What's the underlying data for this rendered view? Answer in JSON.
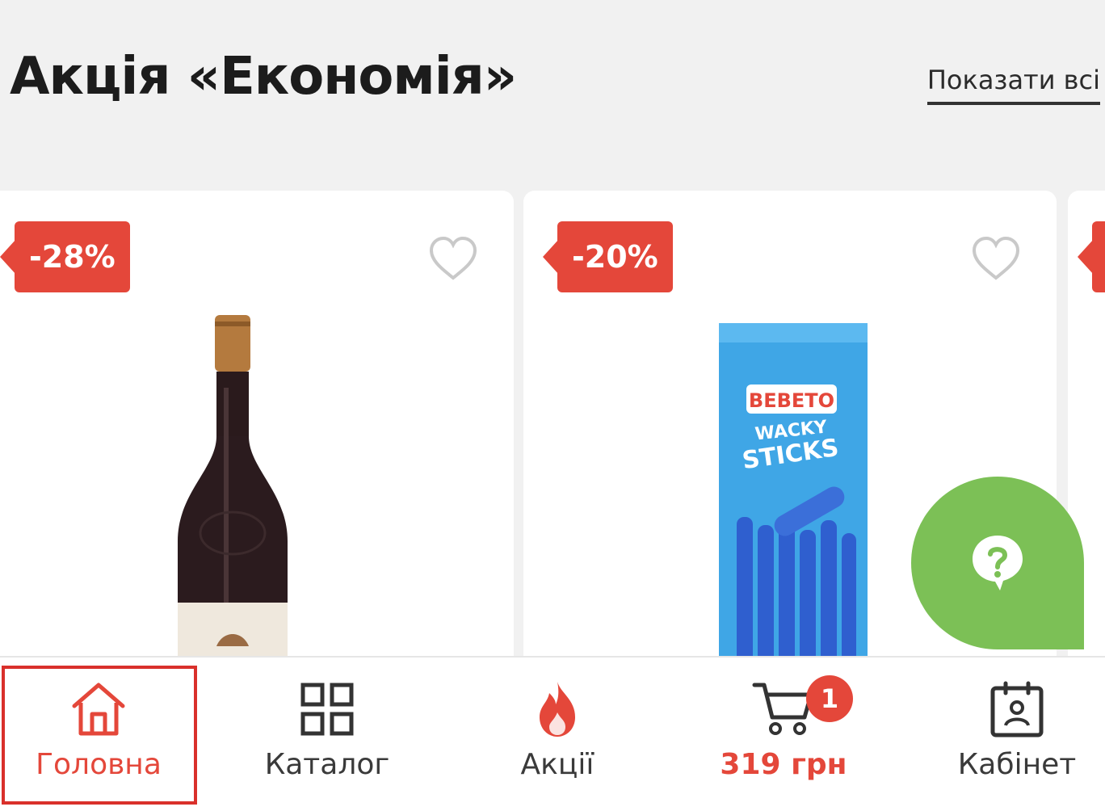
{
  "header": {
    "title": "Акція «Економія»",
    "show_all": "Показати всі"
  },
  "products": [
    {
      "discount": "-28%",
      "image": "red-wine-bottle"
    },
    {
      "discount": "-20%",
      "image": "bebeto-wacky-sticks-package",
      "package_text": [
        "BEBETO",
        "WACKY",
        "STICKS"
      ]
    },
    {
      "discount": "",
      "image": "partially-visible-card"
    }
  ],
  "help": {
    "icon": "question-chat-icon"
  },
  "bottom_nav": {
    "home": "Головна",
    "catalog": "Каталог",
    "promos": "Акції",
    "cart_total": "319 грн",
    "cart_count": "1",
    "account": "Кабінет"
  },
  "colors": {
    "accent_red": "#e4473a",
    "help_green": "#7cc056",
    "background": "#f1f1f1"
  }
}
